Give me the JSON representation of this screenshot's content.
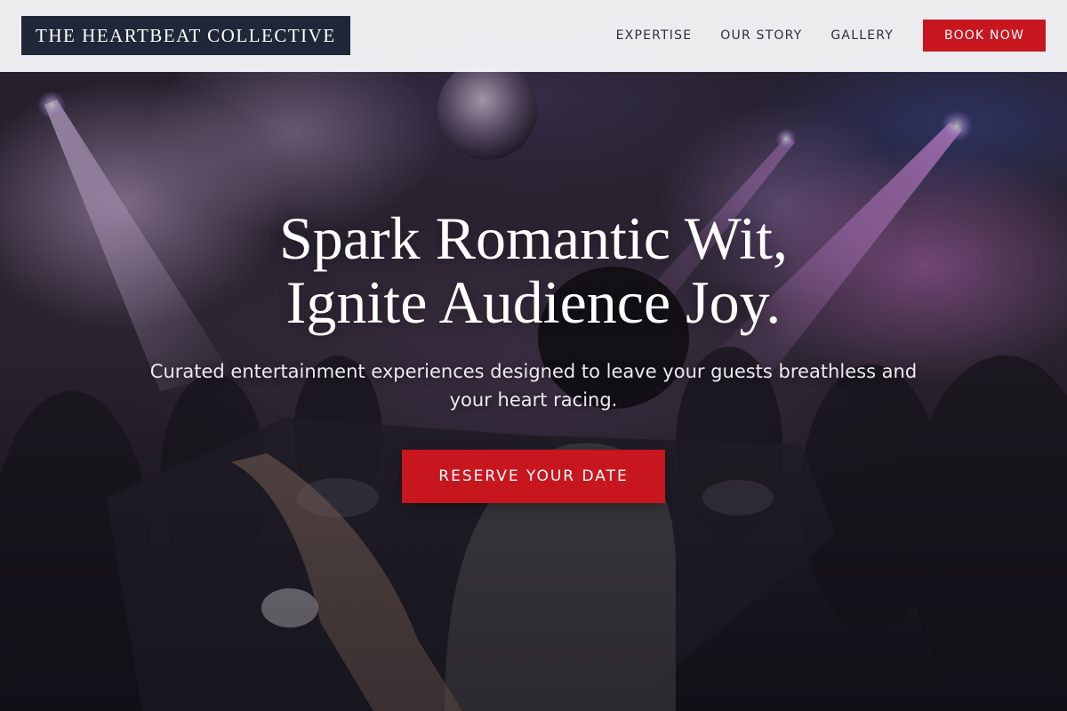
{
  "header": {
    "logo_text": "THE HEARTBEAT COLLECTIVE",
    "nav": [
      {
        "label": "EXPERTISE"
      },
      {
        "label": "OUR STORY"
      },
      {
        "label": "GALLERY"
      }
    ],
    "book_label": "BOOK NOW"
  },
  "hero": {
    "headline_line1": "Spark Romantic Wit,",
    "headline_line2": "Ignite Audience Joy.",
    "subtitle": "Curated entertainment experiences designed to leave your guests breathless and your heart racing.",
    "cta_label": "RESERVE YOUR DATE",
    "background_image": "nightclub-dj-crowd-photo"
  },
  "colors": {
    "accent_red": "#c8161f",
    "logo_navy": "#1f2738",
    "header_bg": "#f3f3f6",
    "text_white": "#ffffff"
  }
}
